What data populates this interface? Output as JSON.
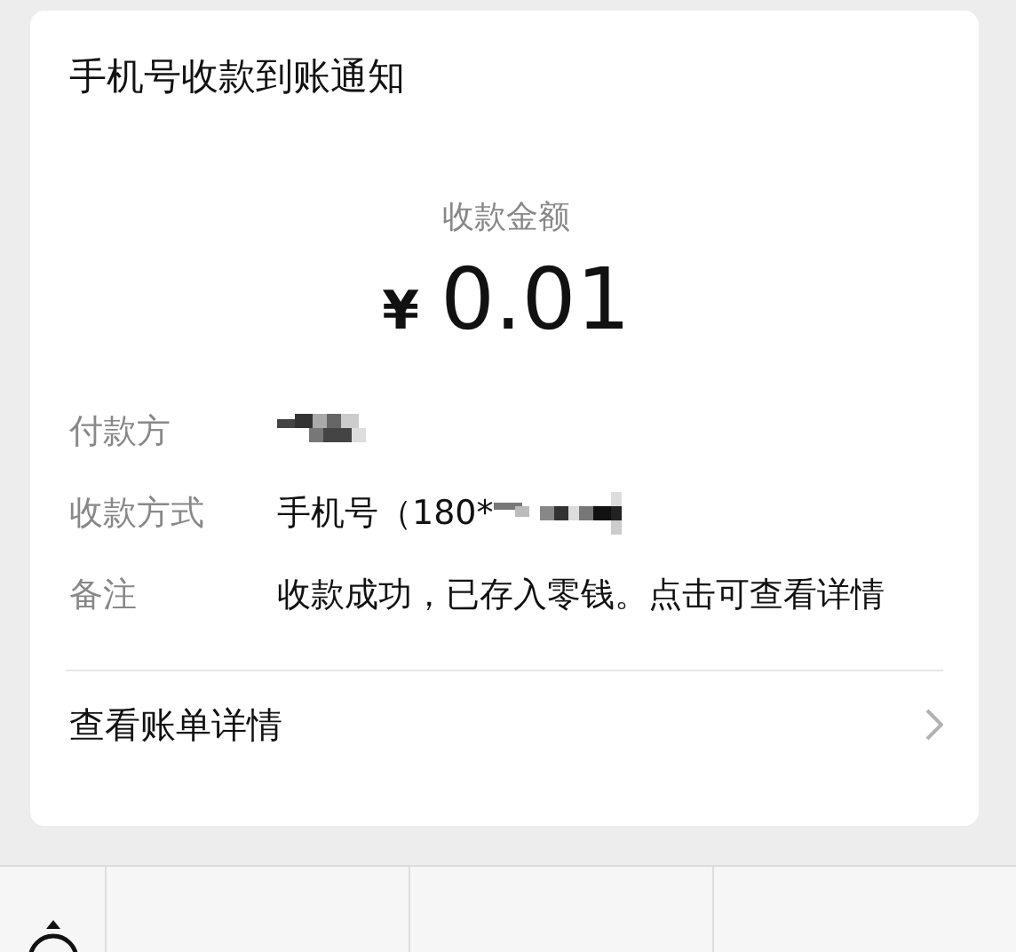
{
  "card": {
    "title": "手机号收款到账通知",
    "amount_label": "收款金额",
    "currency": "¥",
    "amount": "0.01",
    "details": [
      {
        "label": "付款方",
        "kind": "redacted"
      },
      {
        "label": "收款方式",
        "kind": "partial",
        "value": "手机号（180*"
      },
      {
        "label": "备注",
        "kind": "text",
        "value": "收款成功，已存入零钱。点击可查看详情"
      }
    ],
    "footer_link": "查看账单详情"
  }
}
